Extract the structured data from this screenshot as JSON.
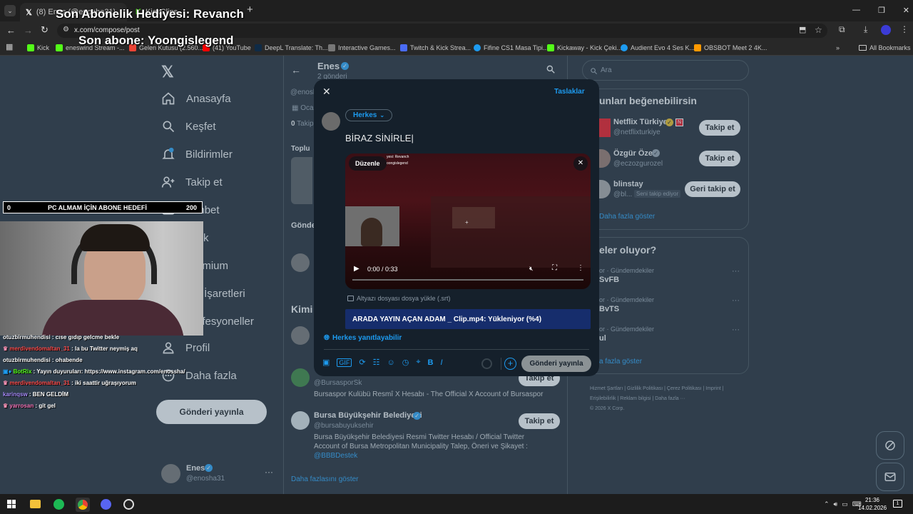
{
  "browser": {
    "tabs": [
      {
        "label": "(8) Enes (@enosha31) / X"
      },
      {
        "label": "KickClips"
      }
    ],
    "url": "x.com/compose/post",
    "bookmarks": [
      {
        "label": "Kick",
        "color": "#53fc18"
      },
      {
        "label": "eneswind Stream -...",
        "color": "#53fc18"
      },
      {
        "label": "Gelen Kutusu (2.560...",
        "color": "#ea4335"
      },
      {
        "label": "(41) YouTube",
        "color": "#ff0000"
      },
      {
        "label": "DeepL Translate: Th...",
        "color": "#0f2b46"
      },
      {
        "label": "Interactive Games...",
        "color": "#777777"
      },
      {
        "label": "Twitch & Kick Strea...",
        "color": "#4a6cf7"
      },
      {
        "label": "Fifine CS1 Masa Tipi...",
        "color": "#1d9bf0"
      },
      {
        "label": "Kickaway - Kick Çeki...",
        "color": "#53fc18"
      },
      {
        "label": "Audient Evo 4 Ses K...",
        "color": "#1d9bf0"
      },
      {
        "label": "OBSBOT Meet 2 4K...",
        "color": "#ff9900"
      }
    ],
    "all_bookmarks": "All Bookmarks"
  },
  "stream_overlay": {
    "sub_gift": "Son Abonelik Hediyesi: Revanch",
    "last_sub": "Son abone: Yoongislegend",
    "goal": {
      "start": "0",
      "label": "PC ALMAM İÇİN ABONE HEDEFİ",
      "end": "200"
    },
    "chat": [
      {
        "user": "otuzbirmuhendisi",
        "msg": ": cıse gıdıp gelcme bekle",
        "color": "#ffffff"
      },
      {
        "user": "merdivendomaltan_31",
        "msg": ": la bu Twitter neymiş aq",
        "color": "#ff4d4d"
      },
      {
        "user": "otuzbirmuhendisi",
        "msg": ": ohabende",
        "color": "#ffffff"
      },
      {
        "user": "BotRix",
        "msg": ": Yayın duyuruları: https://www.instagram.com/enossha/",
        "color": "#53fc18"
      },
      {
        "user": "merdivendomaltan_31",
        "msg": ": iki saattir uğraşıyorum",
        "color": "#ff4d4d"
      },
      {
        "user": "karinqsw",
        "msg": ": BEN GELDİM",
        "color": "#a78bfa"
      },
      {
        "user": "yarrosan",
        "msg": ": git gel",
        "color": "#f472b6"
      }
    ]
  },
  "left_nav": {
    "items": [
      {
        "label": "Anasayfa",
        "icon": "home-icon"
      },
      {
        "label": "Keşfet",
        "icon": "search-icon"
      },
      {
        "label": "Bildirimler",
        "icon": "bell-icon"
      },
      {
        "label": "Takip et",
        "icon": "follow-icon"
      },
      {
        "label": "Sohbet",
        "icon": "mail-icon"
      },
      {
        "label": "Grok",
        "icon": "grok-icon"
      },
      {
        "label": "Premium",
        "icon": "x-icon"
      },
      {
        "label": "Yer İşaretleri",
        "icon": "bookmark-icon"
      },
      {
        "label": "Profesyoneller",
        "icon": "bolt-icon"
      },
      {
        "label": "Profil",
        "icon": "person-icon"
      },
      {
        "label": "Daha fazla",
        "icon": "more-icon"
      }
    ],
    "post_button": "Gönderi yayınla",
    "account": {
      "name": "Enes",
      "handle": "@enosha31"
    }
  },
  "profile_column": {
    "name": "Enes",
    "posts_count": "2 gönderi",
    "handle": "@enosha31",
    "joined": "Ocak",
    "following": "0",
    "following_label": "Takip",
    "photos_label": "Toplu",
    "tab": "Gönde",
    "who_to_follow": "Kimi",
    "suggestions": [
      {
        "name": "",
        "handle": "@BursasporSk",
        "bio": "Bursaspor Kulübü Resmî X Hesabı - The Official X Account of Bursaspor",
        "button": "Takip et"
      },
      {
        "name": "Bursa Büyükşehir Belediyesi",
        "handle": "@bursabuyuksehir",
        "bio": "Bursa Büyükşehir Belediyesi Resmi Twitter Hesabı / Official Twitter Account of Bursa Metropolitan Municipality Talep, Öneri ve Şikayet :",
        "bio_link": "@BBBDestek",
        "button": "Takip et"
      }
    ],
    "show_more": "Daha fazlasını göster"
  },
  "right_column": {
    "search_placeholder": "Ara",
    "suggest_title": "unları beğenebilirsin",
    "suggestions": [
      {
        "name": "Netflix Türkiye",
        "handle": "@netflixturkiye",
        "button": "Takip et",
        "badge": ""
      },
      {
        "name": "Özgür Özel",
        "handle": "@eczozgurozel",
        "button": "Takip et",
        "badge": ""
      },
      {
        "name": "blinstay",
        "handle": "@bl...",
        "button": "Geri takip et",
        "badge": "Seni takip ediyor"
      }
    ],
    "show_more": "Daha fazla göster",
    "trends_title": "eler oluyor?",
    "trends": [
      {
        "meta": "or · Gündemdekiler",
        "topic": "SvFB"
      },
      {
        "meta": "or · Gündemdekiler",
        "topic": "BvTS"
      },
      {
        "meta": "or · Gündemdekiler",
        "topic": "ul"
      }
    ],
    "trends_more": "a fazla göster",
    "footer_links": [
      "Hizmet Şartları",
      "Gizlilik Politikası",
      "Çerez Politikası",
      "Imprint",
      "Erişilebilirlik",
      "Reklam bilgisi",
      "Daha fazla ···"
    ],
    "copyright": "© 2026 X Corp."
  },
  "composer": {
    "drafts": "Taslaklar",
    "audience": "Herkes",
    "text": "BİRAZ SİNİRLE",
    "edit_label": "Düzenle",
    "video_overlay_line1": "yesi: Revanch",
    "video_overlay_line2": "oongislegend",
    "time": "0:00 / 0:33",
    "progress": 0,
    "subtitle_upload": "Altyazı dosyası dosya yükle (.srt)",
    "upload_status": "ARADA YAYIN AÇAN ADAM _ Clip.mp4: Yükleniyor (%4)",
    "reply_setting": "Herkes yanıtlayabilir",
    "post_button": "Gönderi yayınla",
    "accent": "#1d9bf0"
  },
  "taskbar": {
    "time": "21:36",
    "date": "14.02.2026"
  }
}
